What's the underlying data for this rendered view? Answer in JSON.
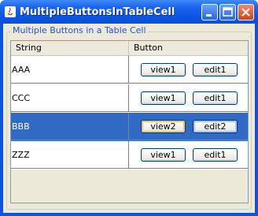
{
  "window": {
    "title": "MultipleButtonsInTableCell"
  },
  "group": {
    "title": "Multiple Buttons in a Table Cell"
  },
  "table": {
    "columns": [
      "String",
      "Button"
    ],
    "rows": [
      {
        "string": "AAA",
        "view": "view1",
        "edit": "edit1"
      },
      {
        "string": "CCC",
        "view": "view1",
        "edit": "edit1"
      },
      {
        "string": "BBB",
        "view": "view2",
        "edit": "edit2"
      },
      {
        "string": "ZZZ",
        "view": "view1",
        "edit": "edit1"
      }
    ],
    "selected_row": "BBB"
  }
}
